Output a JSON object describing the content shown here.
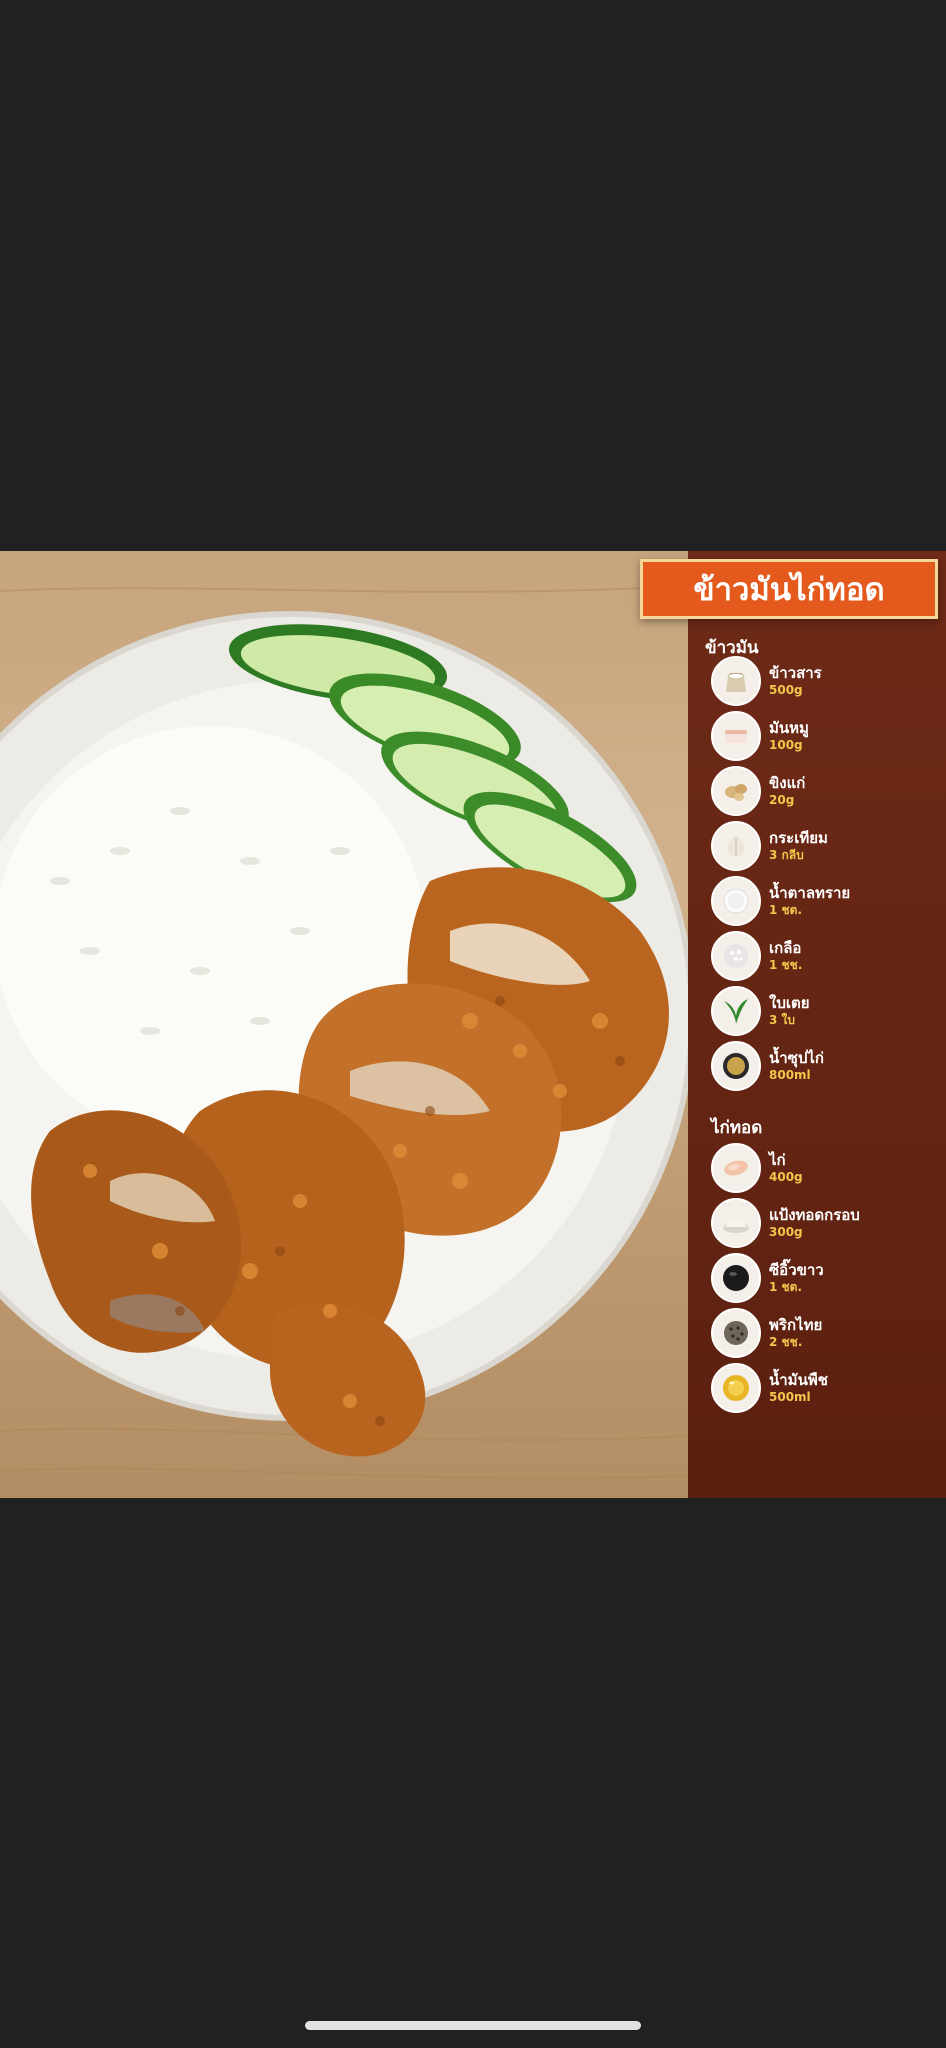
{
  "recipe": {
    "title": "ข้าวมันไก่ทอด",
    "sections": [
      {
        "heading": "ข้าวมัน",
        "items": [
          {
            "name": "ข้าวสาร",
            "amount": "500g",
            "icon": "rice-sack-icon"
          },
          {
            "name": "มันหมู",
            "amount": "100g",
            "icon": "pork-fat-icon"
          },
          {
            "name": "ขิงแก่",
            "amount": "20g",
            "icon": "ginger-icon"
          },
          {
            "name": "กระเทียม",
            "amount": "3 กลีบ",
            "icon": "garlic-icon"
          },
          {
            "name": "น้ำตาลทราย",
            "amount": "1 ชต.",
            "icon": "sugar-icon"
          },
          {
            "name": "เกลือ",
            "amount": "1 ชช.",
            "icon": "salt-icon"
          },
          {
            "name": "ใบเตย",
            "amount": "3 ใบ",
            "icon": "pandan-leaf-icon"
          },
          {
            "name": "น้ำซุปไก่",
            "amount": "800ml",
            "icon": "chicken-broth-icon"
          }
        ]
      },
      {
        "heading": "ไก่ทอด",
        "items": [
          {
            "name": "ไก่",
            "amount": "400g",
            "icon": "chicken-meat-icon"
          },
          {
            "name": "แป้งทอดกรอบ",
            "amount": "300g",
            "icon": "flour-icon"
          },
          {
            "name": "ซีอิ๊วขาว",
            "amount": "1 ชต.",
            "icon": "soy-sauce-icon"
          },
          {
            "name": "พริกไทย",
            "amount": "2 ชช.",
            "icon": "pepper-icon"
          },
          {
            "name": "น้ำมันพืช",
            "amount": "500ml",
            "icon": "vegetable-oil-icon"
          }
        ]
      }
    ]
  },
  "colors": {
    "banner": "#e45a1d",
    "panel": "#6e2a17",
    "amount_text": "#f3c64c",
    "background": "#202122"
  }
}
